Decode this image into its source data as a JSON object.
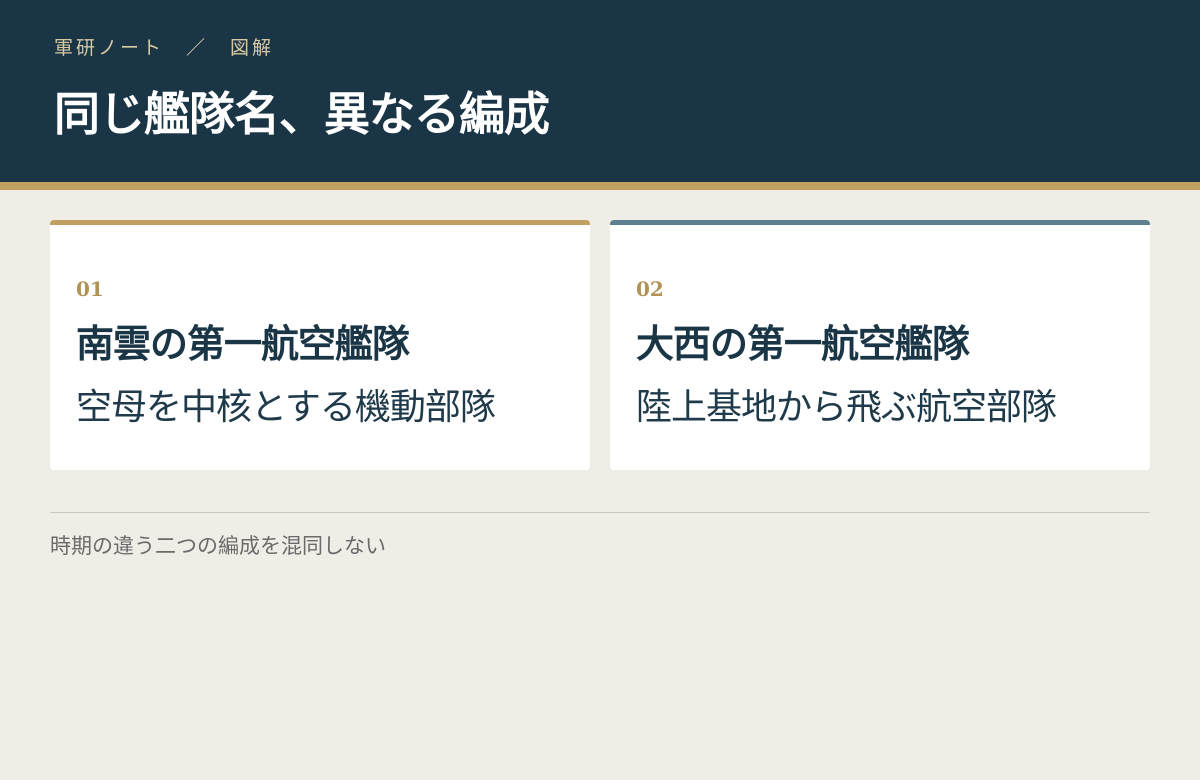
{
  "header": {
    "breadcrumb": [
      "軍研ノート",
      "図解"
    ],
    "breadcrumb_separator": "／",
    "title": "同じ艦隊名、異なる編成"
  },
  "cards": [
    {
      "number": "01",
      "title": "南雲の第一航空艦隊",
      "description": "空母を中核とする機動部隊",
      "accent_color": "#c09f5f"
    },
    {
      "number": "02",
      "title": "大西の第一航空艦隊",
      "description": "陸上基地から飛ぶ航空部隊",
      "accent_color": "#5e7f90"
    }
  ],
  "footnote": "時期の違う二つの編成を混同しない",
  "colors": {
    "header_bg": "#1a3545",
    "gold": "#c09f5f",
    "page_bg": "#f0ede6"
  }
}
